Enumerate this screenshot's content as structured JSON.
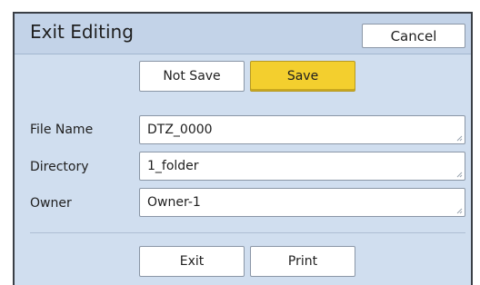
{
  "dialog": {
    "title": "Exit Editing",
    "cancel_label": "Cancel"
  },
  "save_choice": {
    "not_save_label": "Not Save",
    "save_label": "Save",
    "selected": "Save",
    "selected_color": "#f3cf2e"
  },
  "fields": [
    {
      "label": "File Name",
      "value": "DTZ_0000"
    },
    {
      "label": "Directory",
      "value": "1_folder"
    },
    {
      "label": "Owner",
      "value": "Owner-1"
    }
  ],
  "footer": {
    "exit_label": "Exit",
    "print_label": "Print"
  }
}
